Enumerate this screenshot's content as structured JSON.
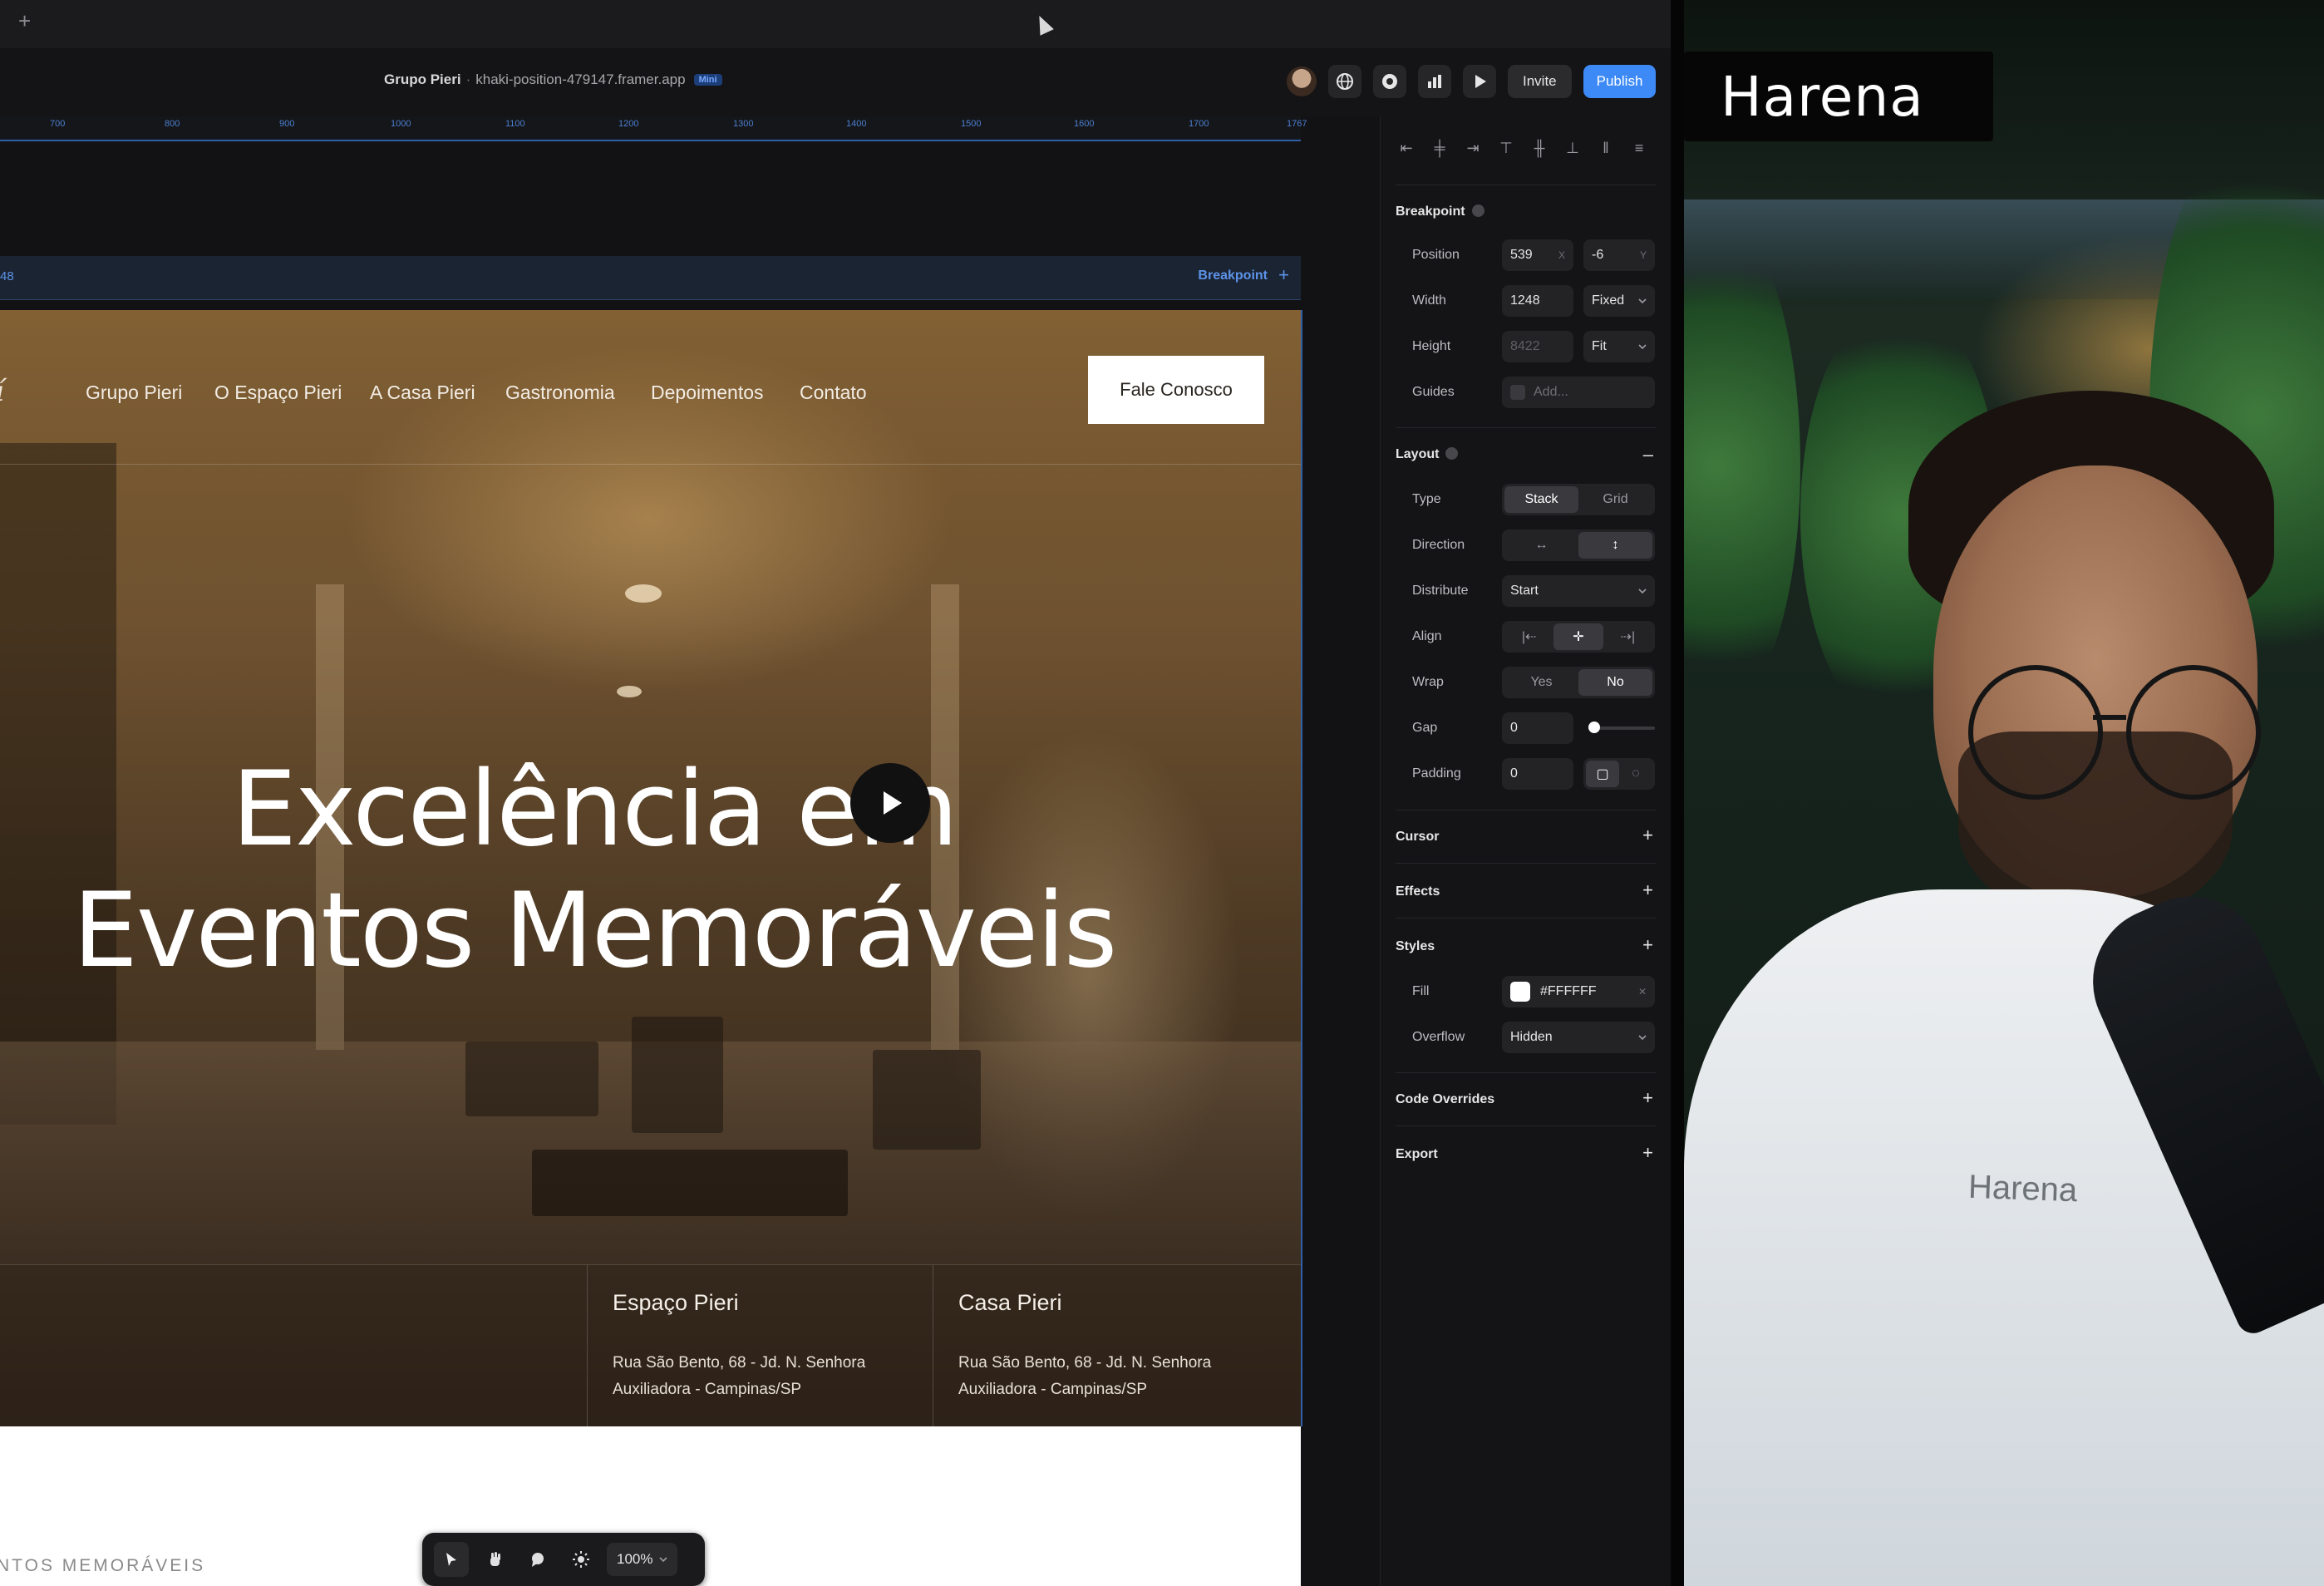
{
  "topbar": {
    "plus_glyph": "+"
  },
  "toolbar": {
    "project_name": "Grupo Pieri",
    "separator": "·",
    "project_url": "khaki-position-479147.framer.app",
    "url_badge": "Mini",
    "invite_label": "Invite",
    "publish_label": "Publish",
    "accent_color": "#3d8af7"
  },
  "canvas": {
    "ruler_ticks": [
      "700",
      "800",
      "900",
      "1000",
      "1100",
      "1200",
      "1300",
      "1400",
      "1500",
      "1600",
      "1700",
      "1767"
    ],
    "breakpoint_number": "48",
    "breakpoint_label": "Breakpoint",
    "breakpoint_plus": "+",
    "bottom_section_label": "NTOS MEMORÁVEIS"
  },
  "site": {
    "nav_items": [
      "Grupo Pieri",
      "O Espaço Pieri",
      "A Casa Pieri",
      "Gastronomia",
      "Depoimentos",
      "Contato"
    ],
    "cta_label": "Fale Conosco",
    "headline_line1": "Excelência em",
    "headline_line2": "Eventos Memoráveis",
    "locations": [
      {
        "title": "Espaço Pieri",
        "address_line1": "Rua São Bento, 68 - Jd. N. Senhora",
        "address_line2": "Auxiliadora - Campinas/SP"
      },
      {
        "title": "Casa Pieri",
        "address_line1": "Rua São Bento, 68 - Jd. N. Senhora",
        "address_line2": "Auxiliadora - Campinas/SP"
      }
    ]
  },
  "floating_toolbar": {
    "zoom": "100%"
  },
  "panel": {
    "breakpoint": {
      "title": "Breakpoint",
      "position_label": "Position",
      "position_x": "539",
      "position_x_suffix": "X",
      "position_y": "-6",
      "position_y_suffix": "Y",
      "width_label": "Width",
      "width_value": "1248",
      "width_mode": "Fixed",
      "height_label": "Height",
      "height_value": "8422",
      "height_mode": "Fit",
      "guides_label": "Guides",
      "guides_placeholder": "Add..."
    },
    "layout": {
      "title": "Layout",
      "collapse": "–",
      "type_label": "Type",
      "type_stack": "Stack",
      "type_grid": "Grid",
      "direction_label": "Direction",
      "distribute_label": "Distribute",
      "distribute_value": "Start",
      "align_label": "Align",
      "wrap_label": "Wrap",
      "wrap_yes": "Yes",
      "wrap_no": "No",
      "gap_label": "Gap",
      "gap_value": "0",
      "gap_slider_fraction": 0,
      "padding_label": "Padding",
      "padding_value": "0"
    },
    "cursor_title": "Cursor",
    "effects_title": "Effects",
    "styles": {
      "title": "Styles",
      "fill_label": "Fill",
      "fill_value": "#FFFFFF",
      "overflow_label": "Overflow",
      "overflow_value": "Hidden"
    },
    "code_overrides_title": "Code Overrides",
    "export_title": "Export",
    "plus": "+"
  },
  "webcam": {
    "brand": "Harena",
    "shirt_text": "Harena"
  }
}
